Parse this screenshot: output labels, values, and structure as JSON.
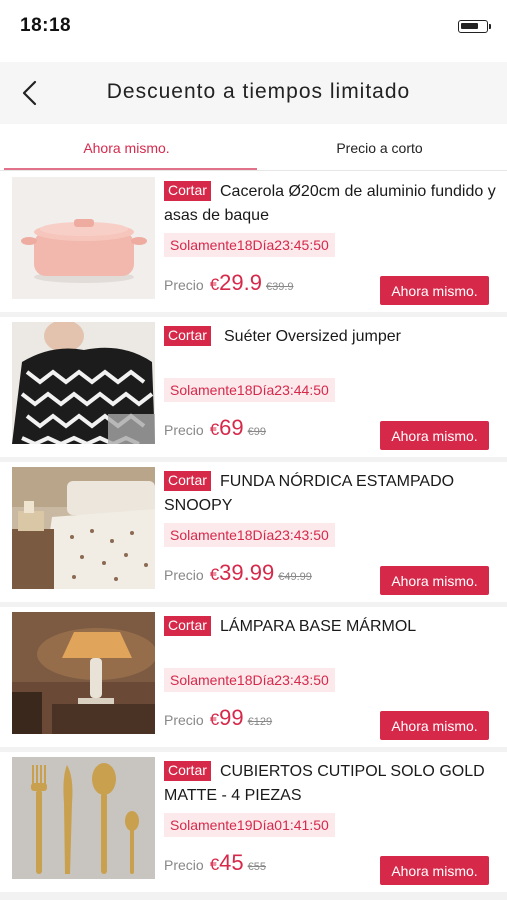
{
  "status_bar": {
    "time": "18:18",
    "battery_level": 0.75
  },
  "nav": {
    "title": "Descuento a tiempos limitado",
    "back_icon": "chevron-left-icon"
  },
  "tabs": [
    {
      "label": "Ahora mismo.",
      "active": true
    },
    {
      "label": "Precio a corto",
      "active": false
    }
  ],
  "colors": {
    "accent": "#d6294a",
    "tag_bg": "#fbe9ec",
    "tab_indicator": "#e2718a"
  },
  "products": [
    {
      "tag": "Cortar",
      "title": "Cacerola Ø20cm de aluminio fundido y asas de baque",
      "timer": "Solamente18Día23:45:50",
      "price_label": "Precio",
      "currency": "€",
      "price": "29.9",
      "old_price": "€39.9",
      "button": "Ahora mismo.",
      "image": "pink-casserole-pot"
    },
    {
      "tag": "Cortar",
      "title": "Suéter Oversized jumper",
      "timer": "Solamente18Día23:44:50",
      "price_label": "Precio",
      "currency": "€",
      "price": "69",
      "old_price": "€99",
      "button": "Ahora mismo.",
      "image": "zigzag-sweater"
    },
    {
      "tag": "Cortar",
      "title": "FUNDA NÓRDICA ESTAMPADO SNOOPY",
      "timer": "Solamente18Día23:43:50",
      "price_label": "Precio",
      "currency": "€",
      "price": "39.99",
      "old_price": "€49.99",
      "button": "Ahora mismo.",
      "image": "bedroom-duvet"
    },
    {
      "tag": "Cortar",
      "title": "LÁMPARA BASE MÁRMOL",
      "timer": "Solamente18Día23:43:50",
      "price_label": "Precio",
      "currency": "€",
      "price": "99",
      "old_price": "€129",
      "button": "Ahora mismo.",
      "image": "marble-lamp"
    },
    {
      "tag": "Cortar",
      "title": "CUBIERTOS CUTIPOL SOLO GOLD MATTE - 4 PIEZAS",
      "timer": "Solamente19Día01:41:50",
      "price_label": "Precio",
      "currency": "€",
      "price": "45",
      "old_price": "€55",
      "button": "Ahora mismo.",
      "image": "gold-cutlery"
    }
  ]
}
